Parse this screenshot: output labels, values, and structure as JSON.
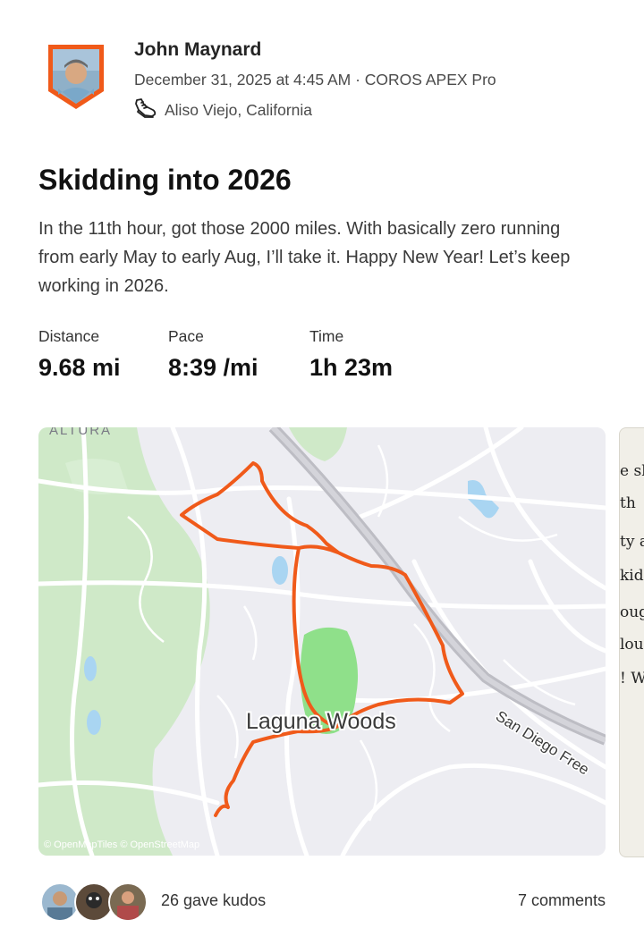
{
  "athlete": {
    "name": "John Maynard",
    "meta": "December 31, 2025 at 4:45 AM · COROS APEX Pro",
    "location": "Aliso Viejo, California",
    "activity_icon": "running-shoe-icon"
  },
  "activity": {
    "title": "Skidding into 2026",
    "description": "In the 11th hour, got those 2000 miles. With basically zero running from early May to early Aug, I’ll take it. Happy New Year! Let’s keep working in 2026."
  },
  "stats": [
    {
      "label": "Distance",
      "value": "9.68 mi"
    },
    {
      "label": "Pace",
      "value": "8:39 /mi"
    },
    {
      "label": "Time",
      "value": "1h 23m"
    }
  ],
  "map": {
    "labels": {
      "top_area": "ALTURA",
      "city": "Laguna Woods",
      "freeway": "San Diego Free"
    },
    "attribution": "© OpenMapTiles © OpenStreetMap",
    "route_color": "#f05a1a",
    "park_color": "#8fe08a",
    "greenbelt_color": "#cfe9c8",
    "water_color": "#a9d5f2"
  },
  "next_card_lines": [
    "e sk",
    "th",
    "ty a",
    "kid",
    "oug",
    "lou",
    "! Wh"
  ],
  "footer": {
    "kudos": "26 gave kudos",
    "comments": "7 comments"
  }
}
